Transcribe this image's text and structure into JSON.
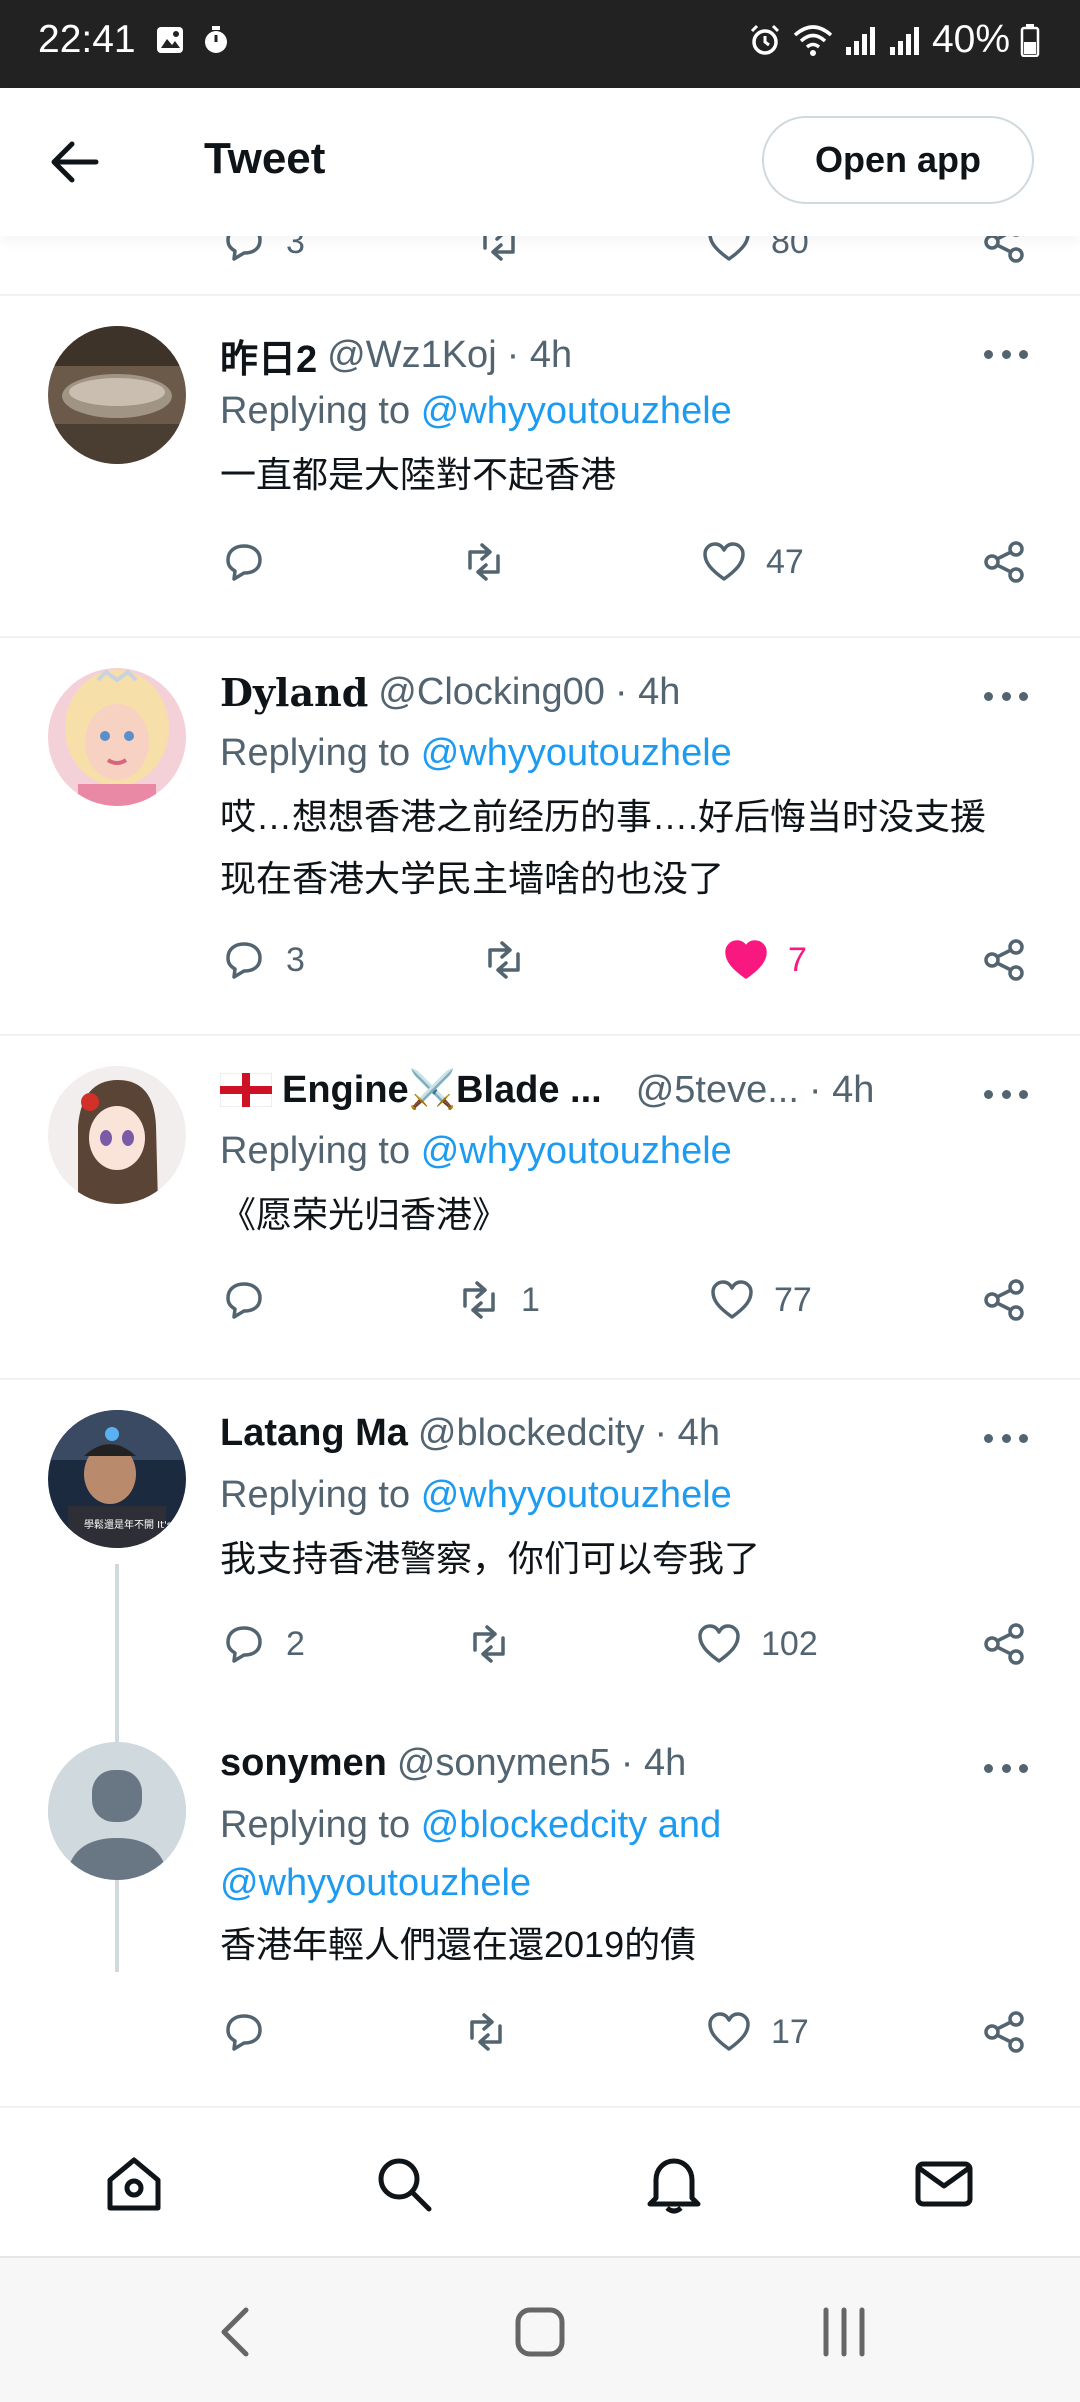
{
  "status_bar": {
    "time": "22:41",
    "battery": "40%"
  },
  "topbar": {
    "title": "Tweet",
    "open_app": "Open app"
  },
  "prev_tweet": {
    "reply_count": "3",
    "like_count": "80"
  },
  "tweets": [
    {
      "name": "昨日2",
      "handle": "@Wz1Koj",
      "time": "· 4h",
      "replying_prefix": "Replying to",
      "replying_to": "@whyyoutouzhele",
      "text": "一直都是大陸對不起香港",
      "replies": "",
      "retweets": "",
      "likes": "47",
      "liked": false
    },
    {
      "name": "Dyland",
      "handle": "@Clocking00",
      "time": "· 4h",
      "replying_prefix": "Replying to",
      "replying_to": "@whyyoutouzhele",
      "text": "哎…想想香港之前经历的事….好后悔当时没支援 现在香港大学民主墙啥的也没了",
      "replies": "3",
      "retweets": "",
      "likes": "7",
      "liked": true
    },
    {
      "name": "Engine⚔️Blade ...",
      "handle": "@5teve...",
      "time": "· 4h",
      "replying_prefix": "Replying to",
      "replying_to": "@whyyoutouzhele",
      "text": "《愿荣光归香港》",
      "replies": "",
      "retweets": "1",
      "likes": "77",
      "liked": false
    },
    {
      "name": "Latang Ma",
      "handle": "@blockedcity",
      "time": "· 4h",
      "replying_prefix": "Replying to",
      "replying_to": "@whyyoutouzhele",
      "text": "我支持香港警察，你们可以夸我了",
      "replies": "2",
      "retweets": "",
      "likes": "102",
      "liked": false
    },
    {
      "name": "sonymen",
      "handle": "@sonymen5",
      "time": "· 4h",
      "replying_prefix": "Replying to",
      "replying_to": "@blockedcity and",
      "replying_to_2": "@whyyoutouzhele",
      "text": "香港年輕人們還在還2019的債",
      "replies": "",
      "retweets": "",
      "likes": "17",
      "liked": false
    }
  ],
  "avatar_texts": {
    "latang": "學鬆還是年不開 It's my duty了"
  },
  "colors": {
    "link": "#1d9bf0",
    "like": "#f91880",
    "secondary": "#536471",
    "primary": "#0f1419"
  },
  "icons": [
    "back-arrow-icon",
    "reply-icon",
    "retweet-icon",
    "heart-icon",
    "share-icon",
    "home-icon",
    "search-icon",
    "bell-icon",
    "mail-icon"
  ]
}
